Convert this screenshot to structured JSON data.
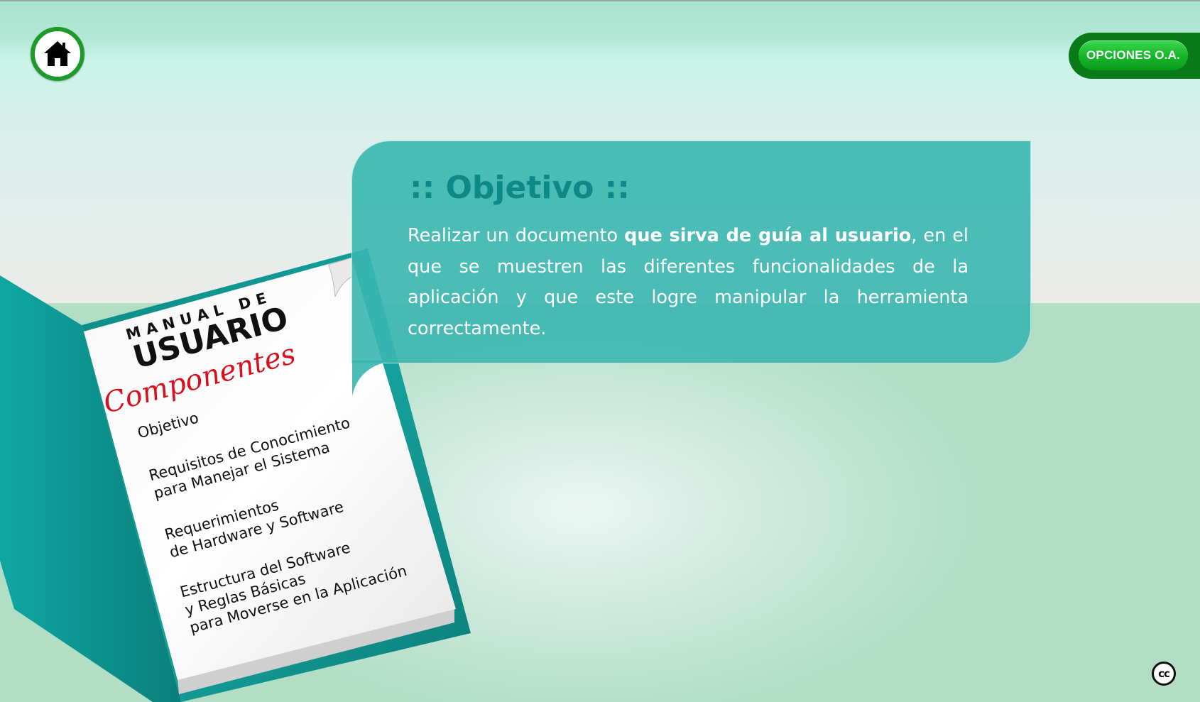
{
  "header": {
    "home_icon": "home-icon",
    "options_button": "OPCIONES O.A."
  },
  "objective": {
    "title": ":: Objetivo ::",
    "text_before": "Realizar un documento ",
    "text_bold": "que sirva de guía al usuario",
    "text_after": ", en el que se muestren las diferentes funcionalidades de la aplicación y que este logre manipular la herramienta correctamente."
  },
  "manual": {
    "heading_small": "MANUAL DE",
    "heading_large": "USUARIO",
    "subheading": "Componentes",
    "items": [
      {
        "lines": [
          "Objetivo"
        ]
      },
      {
        "lines": [
          "Requisitos de Conocimiento",
          "para Manejar el Sistema"
        ]
      },
      {
        "lines": [
          "Requerimientos",
          "de Hardware y Software"
        ]
      },
      {
        "lines": [
          "Estructura del Software",
          "y Reglas Básicas",
          "para Moverse en la Aplicación"
        ]
      }
    ]
  },
  "footer": {
    "cc_label": "cc",
    "cc_icon": "creative-commons-icon"
  },
  "colors": {
    "teal": "#3ab6b0",
    "title_teal": "#0d8a85",
    "green_button": "#17b82b",
    "red_script": "#d8101e"
  }
}
